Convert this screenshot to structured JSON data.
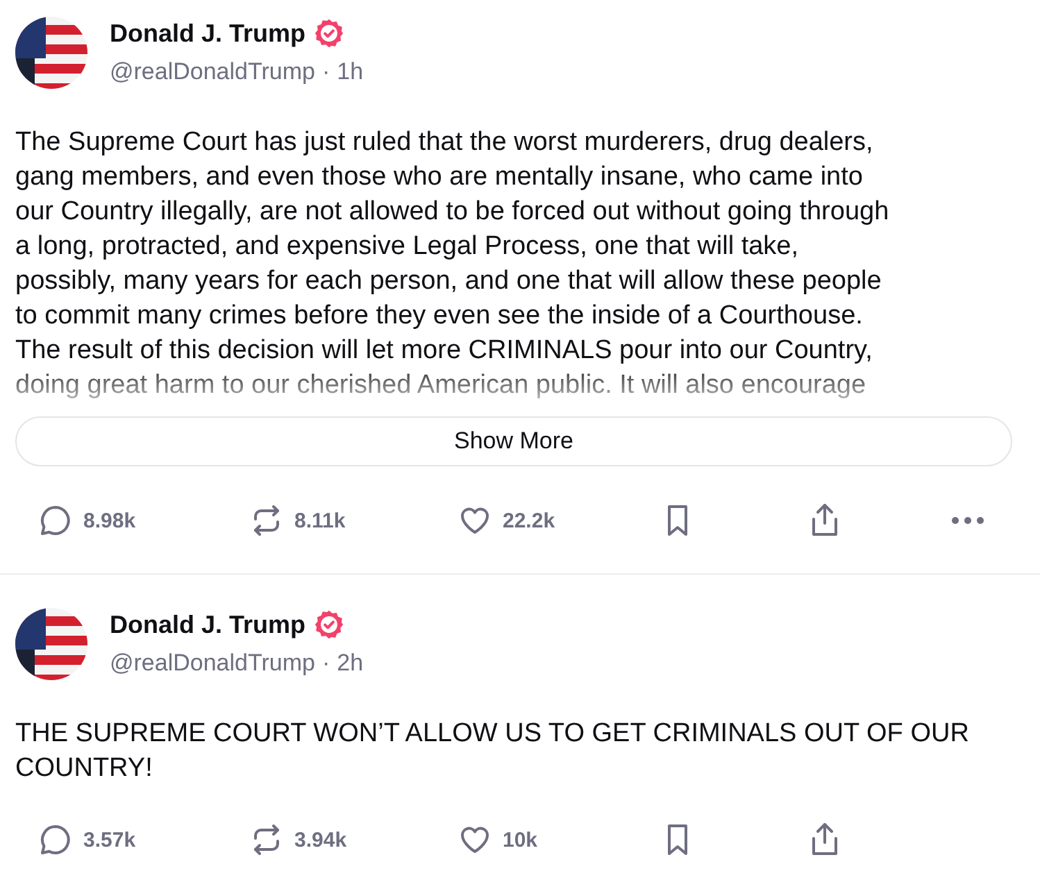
{
  "posts": [
    {
      "author": "Donald J. Trump",
      "verified": true,
      "handle": "@realDonaldTrump",
      "separator": "·",
      "time": "1h",
      "truncated": true,
      "text_lines": [
        "The Supreme Court has just ruled that the worst murderers, drug dealers,",
        "gang members, and even those who are mentally insane, who came into",
        "our Country illegally, are not allowed to be forced out without going through",
        "a long, protracted, and expensive Legal Process, one that will take,",
        "possibly, many years for each person, and one that will allow these people",
        "to commit many crimes before they even see the inside of a Courthouse.",
        "The result of this decision will let more CRIMINALS pour into our Country,",
        "doing great harm to our cherished American public. It will also encourage"
      ],
      "show_more": "Show More",
      "actions": [
        {
          "kind": "reply",
          "count": "8.98k"
        },
        {
          "kind": "repost",
          "count": "8.11k"
        },
        {
          "kind": "like",
          "count": "22.2k"
        },
        {
          "kind": "bookmark"
        },
        {
          "kind": "share"
        },
        {
          "kind": "more"
        }
      ]
    },
    {
      "author": "Donald J. Trump",
      "verified": true,
      "handle": "@realDonaldTrump",
      "separator": "·",
      "time": "2h",
      "truncated": false,
      "text_lines": [
        "THE SUPREME COURT WON’T ALLOW US TO GET CRIMINALS OUT OF OUR",
        "COUNTRY!"
      ],
      "actions": [
        {
          "kind": "reply",
          "count": "3.57k"
        },
        {
          "kind": "repost",
          "count": "3.94k"
        },
        {
          "kind": "like",
          "count": "10k"
        },
        {
          "kind": "bookmark"
        },
        {
          "kind": "share"
        }
      ]
    }
  ]
}
